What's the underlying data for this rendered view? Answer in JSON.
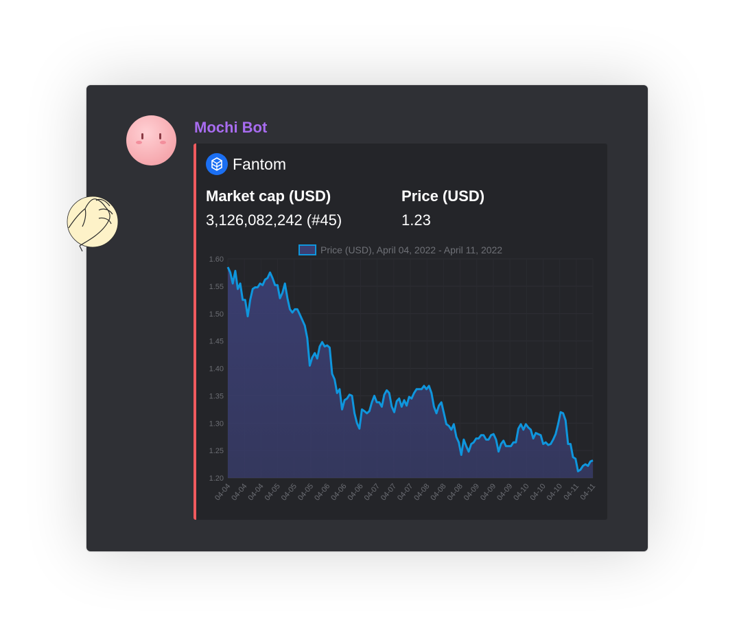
{
  "message": {
    "author": "Mochi Bot",
    "embed": {
      "coin_name": "Fantom",
      "fields": [
        {
          "name": "Market cap (USD)",
          "value": "3,126,082,242 (#45)"
        },
        {
          "name": "Price (USD)",
          "value": "1.23"
        }
      ]
    }
  },
  "colors": {
    "accent_bar": "#f05a5e",
    "author_name": "#a86cf0",
    "line": "#0f96dd",
    "fill": "#3b3f73"
  },
  "icons": {
    "avatar": "mochi-face-avatar",
    "wave": "waving-hand-icon",
    "coin": "fantom-logo-icon"
  },
  "chart_data": {
    "type": "area",
    "legend_label": "Price (USD), April 04, 2022 - April 11, 2022",
    "legend_position": "top",
    "ylim": [
      1.2,
      1.6
    ],
    "yticks": [
      "1.60",
      "1.55",
      "1.50",
      "1.45",
      "1.40",
      "1.35",
      "1.30",
      "1.25",
      "1.20"
    ],
    "xticks": [
      "04-04",
      "04-04",
      "04-04",
      "04-05",
      "04-05",
      "04-05",
      "04-06",
      "04-06",
      "04-06",
      "04-07",
      "04-07",
      "04-07",
      "04-08",
      "04-08",
      "04-08",
      "04-09",
      "04-09",
      "04-09",
      "04-10",
      "04-10",
      "04-10",
      "04-11",
      "04-11"
    ],
    "grid": true,
    "series": [
      {
        "values": [
          1.585,
          1.575,
          1.555,
          1.578,
          1.545,
          1.555,
          1.525,
          1.525,
          1.495,
          1.525,
          1.545,
          1.548,
          1.548,
          1.555,
          1.552,
          1.562,
          1.565,
          1.575,
          1.565,
          1.552,
          1.552,
          1.528,
          1.538,
          1.555,
          1.528,
          1.508,
          1.502,
          1.508,
          1.508,
          1.498,
          1.488,
          1.478,
          1.455,
          1.405,
          1.42,
          1.428,
          1.418,
          1.44,
          1.448,
          1.44,
          1.442,
          1.438,
          1.39,
          1.38,
          1.355,
          1.362,
          1.325,
          1.342,
          1.345,
          1.352,
          1.35,
          1.318,
          1.3,
          1.29,
          1.325,
          1.322,
          1.318,
          1.322,
          1.338,
          1.35,
          1.338,
          1.338,
          1.33,
          1.352,
          1.36,
          1.355,
          1.33,
          1.32,
          1.34,
          1.345,
          1.33,
          1.342,
          1.332,
          1.348,
          1.345,
          1.355,
          1.362,
          1.362,
          1.362,
          1.368,
          1.362,
          1.368,
          1.355,
          1.33,
          1.318,
          1.332,
          1.338,
          1.318,
          1.298,
          1.295,
          1.288,
          1.298,
          1.275,
          1.265,
          1.242,
          1.27,
          1.258,
          1.248,
          1.262,
          1.265,
          1.272,
          1.272,
          1.278,
          1.278,
          1.27,
          1.27,
          1.278,
          1.28,
          1.27,
          1.248,
          1.262,
          1.268,
          1.258,
          1.258,
          1.258,
          1.265,
          1.265,
          1.29,
          1.298,
          1.288,
          1.298,
          1.292,
          1.288,
          1.272,
          1.282,
          1.28,
          1.278,
          1.262,
          1.265,
          1.26,
          1.262,
          1.27,
          1.28,
          1.298,
          1.32,
          1.318,
          1.305,
          1.262,
          1.262,
          1.238,
          1.235,
          1.212,
          1.215,
          1.222,
          1.225,
          1.222,
          1.23,
          1.232
        ]
      }
    ]
  }
}
